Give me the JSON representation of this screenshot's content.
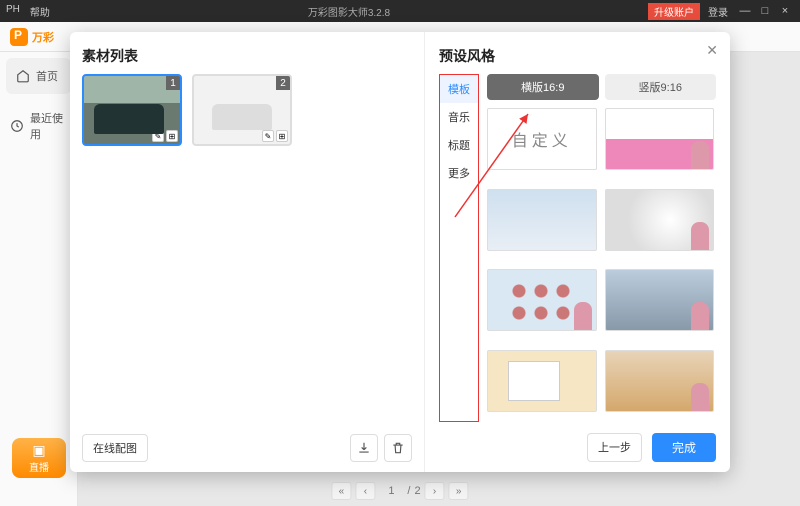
{
  "titlebar": {
    "menu_left": [
      "PH",
      "帮助"
    ],
    "title": "万彩图影大师3.2.8",
    "upgrade": "升级账户",
    "login": "登录"
  },
  "toolbar": {
    "brand": "万彩"
  },
  "sidebar": {
    "home": "首页",
    "recent": "最近使用"
  },
  "orange_btn": "直播",
  "pagination": {
    "current": "1",
    "sep": "/",
    "total": "2"
  },
  "modal": {
    "left_title": "素材列表",
    "thumbs": [
      {
        "n": "1"
      },
      {
        "n": "2"
      }
    ],
    "online_btn": "在线配图",
    "right_title": "预设风格",
    "style_menu": [
      "模板",
      "音乐",
      "标题",
      "更多"
    ],
    "orient": {
      "landscape": "横版16:9",
      "portrait": "竖版9:16"
    },
    "custom_label": "自定义",
    "prev": "上一步",
    "finish": "完成"
  }
}
